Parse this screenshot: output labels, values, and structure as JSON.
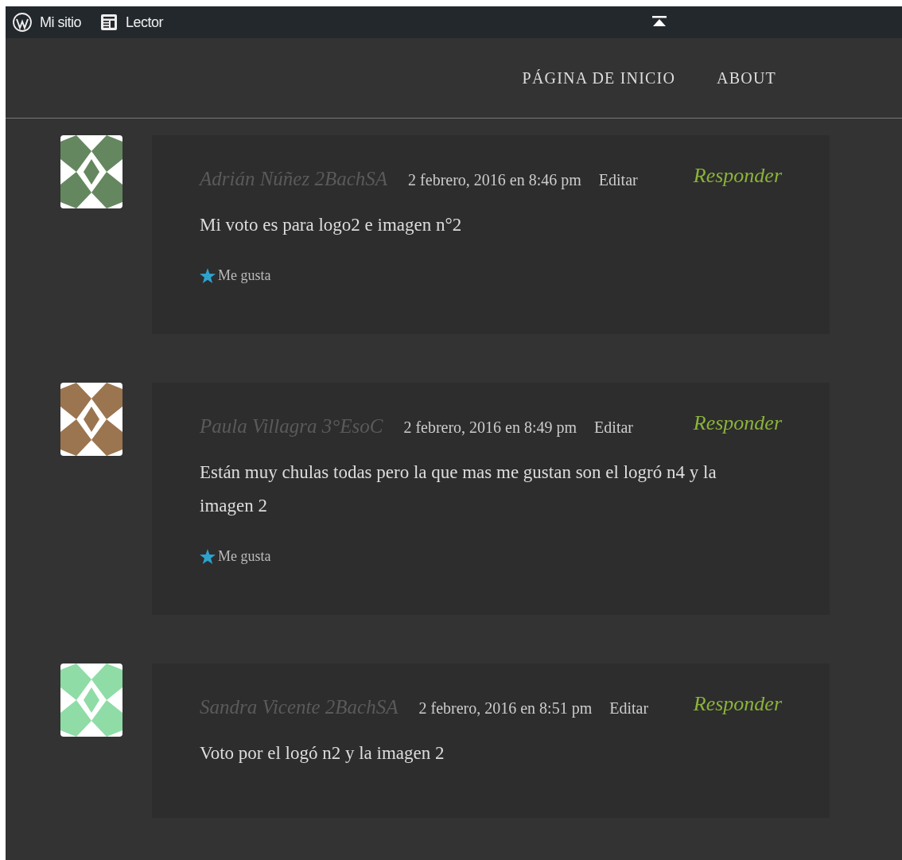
{
  "admin_bar": {
    "items": [
      {
        "kind": "wordpress",
        "label": "Mi sitio"
      },
      {
        "kind": "reader",
        "label": "Lector"
      }
    ]
  },
  "nav": {
    "items": [
      {
        "label": "PÁGINA DE INICIO"
      },
      {
        "label": "ABOUT"
      }
    ]
  },
  "comments": [
    {
      "author": "Adrián Núñez 2BachSA",
      "date": "2 febrero, 2016 en 8:46 pm",
      "edit": "Editar",
      "reply": "Responder",
      "color": "#64875f",
      "paragraphs": [
        "Mi voto es para logo2 e imagen n°2"
      ],
      "like": "Me gusta"
    },
    {
      "author": "Paula Villagra 3°EsoC",
      "date": "2 febrero, 2016 en 8:49 pm",
      "edit": "Editar",
      "reply": "Responder",
      "color": "#9a7550",
      "paragraphs": [
        "Están muy chulas todas pero la que mas me gustan son el logró n4 y la imagen 2"
      ],
      "like": "Me gusta"
    },
    {
      "author": "Sandra Vicente 2BachSA",
      "date": "2 febrero, 2016 en 8:51 pm",
      "edit": "Editar",
      "reply": "Responder",
      "color": "#8fdca6",
      "paragraphs": [
        "Voto por el logó n2 y la imagen 2"
      ]
    }
  ]
}
